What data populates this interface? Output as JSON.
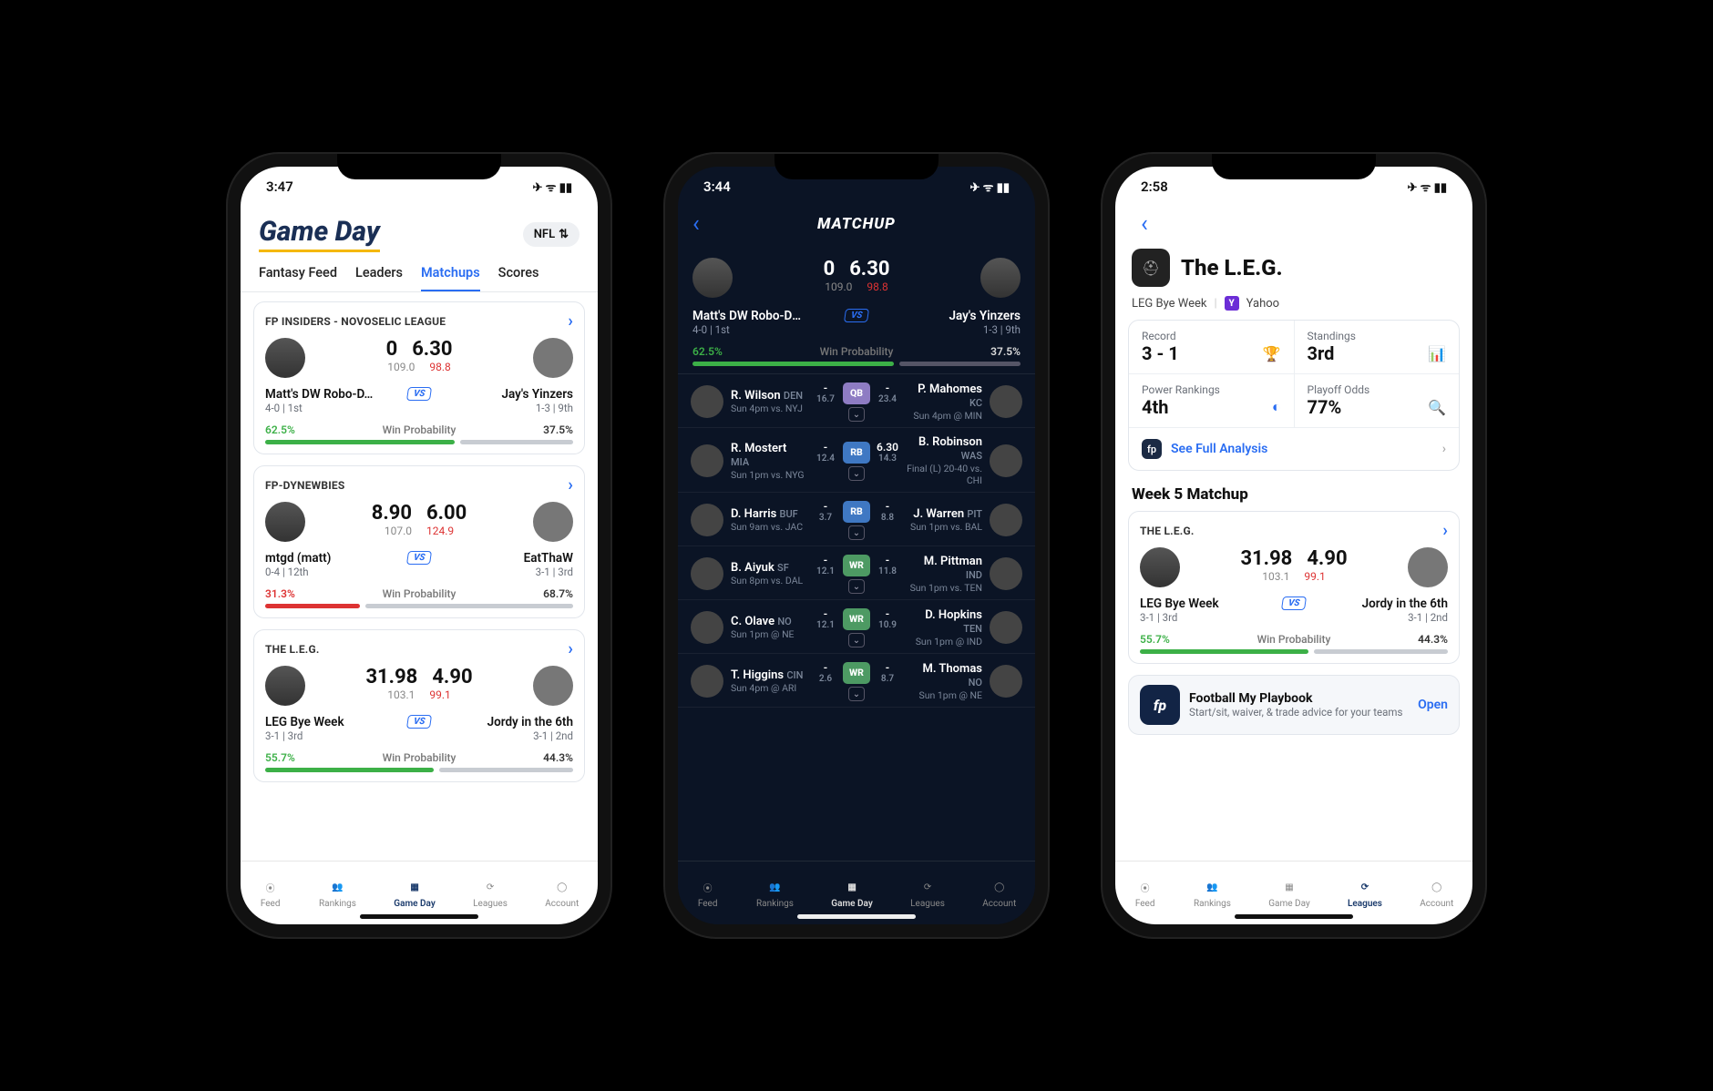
{
  "statusbar_icons": "✈ ᯤ ▮▮",
  "screen1": {
    "time": "3:47",
    "title": "Game Day",
    "league_pill": "NFL",
    "tabs": [
      "Fantasy Feed",
      "Leaders",
      "Matchups",
      "Scores"
    ],
    "active_tab": 2,
    "cards": [
      {
        "league": "FP INSIDERS - NOVOSELIC LEAGUE",
        "left": {
          "name": "Matt's DW Robo-D...",
          "sub": "4-0 | 1st"
        },
        "right": {
          "name": "Jay's Yinzers",
          "sub": "1-3 | 9th"
        },
        "s1": "0",
        "s2": "6.30",
        "p1": "109.0",
        "p2": "98.8",
        "lp": "62.5%",
        "rp": "37.5%",
        "wp": "Win Probability",
        "barL": 62.5,
        "colL": "#3cb047",
        "colR": "#c8ccd2"
      },
      {
        "league": "FP-DYNEWBIES",
        "left": {
          "name": "mtgd (matt)",
          "sub": "0-4 | 12th"
        },
        "right": {
          "name": "EatThaW",
          "sub": "3-1 | 3rd"
        },
        "s1": "8.90",
        "s2": "6.00",
        "p1": "107.0",
        "p2": "124.9",
        "lp": "31.3%",
        "rp": "68.7%",
        "wp": "Win Probability",
        "barL": 31.3,
        "colL": "#d33",
        "colR": "#c8ccd2"
      },
      {
        "league": "THE L.E.G.",
        "left": {
          "name": "LEG Bye Week",
          "sub": "3-1 | 3rd"
        },
        "right": {
          "name": "Jordy in the 6th",
          "sub": "3-1 | 2nd"
        },
        "s1": "31.98",
        "s2": "4.90",
        "p1": "103.1",
        "p2": "99.1",
        "lp": "55.7%",
        "rp": "44.3%",
        "wp": "Win Probability",
        "barL": 55.7,
        "colL": "#3cb047",
        "colR": "#c8ccd2"
      }
    ],
    "bottom_tabs": [
      "Feed",
      "Rankings",
      "Game Day",
      "Leagues",
      "Account"
    ],
    "bottom_active": 2
  },
  "screen2": {
    "time": "3:44",
    "title": "MATCHUP",
    "top": {
      "s1": "0",
      "s2": "6.30",
      "p1": "109.0",
      "p2": "98.8",
      "l": {
        "name": "Matt's DW Robo-Dr...",
        "sub": "4-0 | 1st"
      },
      "r": {
        "name": "Jay's Yinzers",
        "sub": "1-3 | 9th"
      },
      "lp": "62.5%",
      "rp": "37.5%",
      "wp": "Win Probability"
    },
    "rows": [
      {
        "pos": "QB",
        "col": "#8e7cc3",
        "ls": "-",
        "lp": "16.7",
        "rs": "-",
        "rp": "23.4",
        "l": {
          "n": "R. Wilson",
          "t": "DEN",
          "i": "Sun 4pm vs. NYJ"
        },
        "r": {
          "n": "P. Mahomes",
          "t": "KC",
          "i": "Sun 4pm @ MIN"
        }
      },
      {
        "pos": "RB",
        "col": "#3f78c3",
        "ls": "-",
        "lp": "12.4",
        "rs": "6.30",
        "rp": "14.3",
        "l": {
          "n": "R. Mostert",
          "t": "MIA",
          "i": "Sun 1pm vs. NYG"
        },
        "r": {
          "n": "B. Robinson",
          "t": "WAS",
          "i": "Final (L) 20-40 vs. CHI"
        }
      },
      {
        "pos": "RB",
        "col": "#3f78c3",
        "ls": "-",
        "lp": "3.7",
        "rs": "-",
        "rp": "8.8",
        "l": {
          "n": "D. Harris",
          "t": "BUF",
          "i": "Sun 9am vs. JAC"
        },
        "r": {
          "n": "J. Warren",
          "t": "PIT",
          "i": "Sun 1pm vs. BAL"
        }
      },
      {
        "pos": "WR",
        "col": "#4d9a63",
        "ls": "-",
        "lp": "12.1",
        "rs": "-",
        "rp": "11.8",
        "l": {
          "n": "B. Aiyuk",
          "t": "SF",
          "i": "Sun 8pm vs. DAL"
        },
        "r": {
          "n": "M. Pittman",
          "t": "IND",
          "i": "Sun 1pm vs. TEN"
        }
      },
      {
        "pos": "WR",
        "col": "#4d9a63",
        "ls": "-",
        "lp": "12.1",
        "rs": "-",
        "rp": "10.9",
        "l": {
          "n": "C. Olave",
          "t": "NO",
          "i": "Sun 1pm @ NE"
        },
        "r": {
          "n": "D. Hopkins",
          "t": "TEN",
          "i": "Sun 1pm @ IND"
        }
      },
      {
        "pos": "WR",
        "col": "#4d9a63",
        "ls": "-",
        "lp": "2.6",
        "rs": "-",
        "rp": "8.7",
        "l": {
          "n": "T. Higgins",
          "t": "CIN",
          "i": "Sun 4pm @ ARI"
        },
        "r": {
          "n": "M. Thomas",
          "t": "NO",
          "i": "Sun 1pm @ NE"
        }
      }
    ],
    "bottom_tabs": [
      "Feed",
      "Rankings",
      "Game Day",
      "Leagues",
      "Account"
    ],
    "bottom_active": 2
  },
  "screen3": {
    "time": "2:58",
    "title": "The L.E.G.",
    "subtitle": "LEG Bye Week",
    "provider": "Yahoo",
    "stats": [
      {
        "lbl": "Record",
        "val": "3 - 1",
        "icon": "trophy"
      },
      {
        "lbl": "Standings",
        "val": "3rd",
        "icon": "podium"
      },
      {
        "lbl": "Power Rankings",
        "val": "4th",
        "icon": "gauge"
      },
      {
        "lbl": "Playoff Odds",
        "val": "77%",
        "icon": "magnify"
      }
    ],
    "analysis_link": "See Full Analysis",
    "matchup_hdr": "Week 5 Matchup",
    "card": {
      "league": "THE L.E.G.",
      "left": {
        "name": "LEG Bye Week",
        "sub": "3-1 | 3rd"
      },
      "right": {
        "name": "Jordy in the 6th",
        "sub": "3-1 | 2nd"
      },
      "s1": "31.98",
      "s2": "4.90",
      "p1": "103.1",
      "p2": "99.1",
      "lp": "55.7%",
      "rp": "44.3%",
      "wp": "Win Probability",
      "barL": 55.7,
      "colL": "#3cb047",
      "colR": "#c8ccd2"
    },
    "promo": {
      "title": "Football My Playbook",
      "sub": "Start/sit, waiver, & trade advice for your teams",
      "cta": "Open"
    },
    "bottom_tabs": [
      "Feed",
      "Rankings",
      "Game Day",
      "Leagues",
      "Account"
    ],
    "bottom_active": 3
  },
  "vs_label": "VS"
}
